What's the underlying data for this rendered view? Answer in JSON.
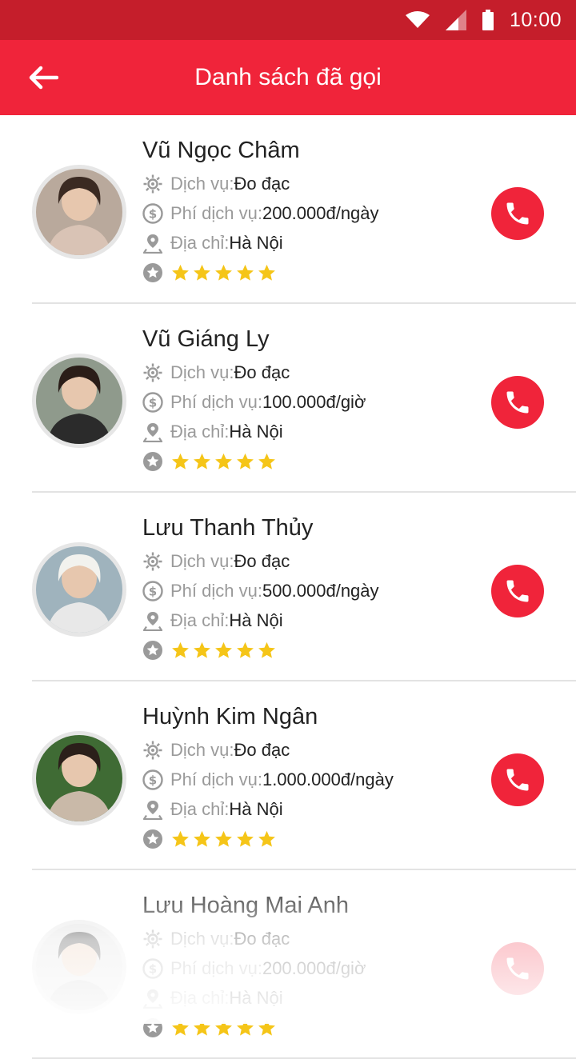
{
  "status_bar": {
    "time": "10:00"
  },
  "header": {
    "title": "Danh sách đã gọi"
  },
  "labels": {
    "service": "Dịch vụ:",
    "fee": "Phí dịch vụ:",
    "address": "Địa chỉ:"
  },
  "colors": {
    "accent": "#f0243a",
    "status_bar": "#c51e2b",
    "star": "#f5c518",
    "icon_gray": "#9a9a9a"
  },
  "items": [
    {
      "name": "Vũ Ngọc Châm",
      "service": "Đo đạc",
      "fee": "200.000đ/ngày",
      "address": "Hà Nội",
      "rating": 5,
      "avatar": "woman-portrait-photo"
    },
    {
      "name": "Vũ Giáng Ly",
      "service": "Đo đạc",
      "fee": "100.000đ/giờ",
      "address": "Hà Nội",
      "rating": 5,
      "avatar": "woman-portrait-photo"
    },
    {
      "name": "Lưu Thanh Thủy",
      "service": "Đo đạc",
      "fee": "500.000đ/ngày",
      "address": "Hà Nội",
      "rating": 5,
      "avatar": "woman-hat-sea-photo"
    },
    {
      "name": "Huỳnh Kim Ngân",
      "service": "Đo đạc",
      "fee": "1.000.000đ/ngày",
      "address": "Hà Nội",
      "rating": 5,
      "avatar": "woman-glasses-leaves-photo"
    },
    {
      "name": "Lưu Hoàng Mai Anh",
      "service": "Đo đạc",
      "fee": "200.000đ/giờ",
      "address": "Hà Nội",
      "rating": 5,
      "avatar": "woman-portrait-photo"
    }
  ]
}
